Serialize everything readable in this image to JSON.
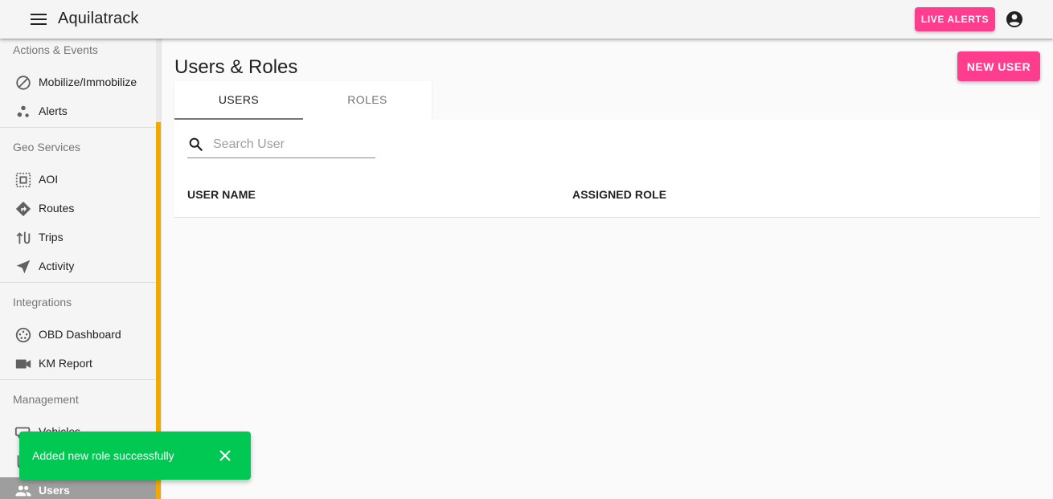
{
  "app": {
    "title": "Aquilatrack"
  },
  "header": {
    "live_alerts_label": "LIVE ALERTS"
  },
  "sidebar": {
    "sections": [
      {
        "title": "Actions & Events",
        "items": [
          {
            "label": "Mobilize/Immobilize",
            "icon": "block-icon"
          },
          {
            "label": "Alerts",
            "icon": "bubbles-icon"
          }
        ]
      },
      {
        "title": "Geo Services",
        "items": [
          {
            "label": "AOI",
            "icon": "select-area-icon"
          },
          {
            "label": "Routes",
            "icon": "directions-icon"
          },
          {
            "label": "Trips",
            "icon": "swap-vertical-icon"
          },
          {
            "label": "Activity",
            "icon": "navigation-icon"
          }
        ]
      },
      {
        "title": "Integrations",
        "items": [
          {
            "label": "OBD Dashboard",
            "icon": "obd-port-icon"
          },
          {
            "label": "KM Report",
            "icon": "videocam-icon"
          }
        ]
      },
      {
        "title": "Management",
        "items": [
          {
            "label": "Vehicles",
            "icon": "vehicle-icon"
          },
          {
            "label": "",
            "icon": "device-icon"
          },
          {
            "label": "Users",
            "icon": "people-icon",
            "active": true
          }
        ]
      }
    ]
  },
  "main": {
    "page_title": "Users & Roles",
    "new_user_label": "NEW USER",
    "tabs": [
      {
        "label": "USERS",
        "selected": true
      },
      {
        "label": "ROLES",
        "selected": false
      }
    ],
    "search": {
      "placeholder": "Search User",
      "value": ""
    },
    "table": {
      "columns": [
        "USER NAME",
        "ASSIGNED ROLE"
      ],
      "rows": []
    }
  },
  "snackbar": {
    "message": "Added new role successfully"
  },
  "colors": {
    "accent": "#ff3d8e",
    "success": "#00c853",
    "scroll_thumb": "#f1a800"
  }
}
